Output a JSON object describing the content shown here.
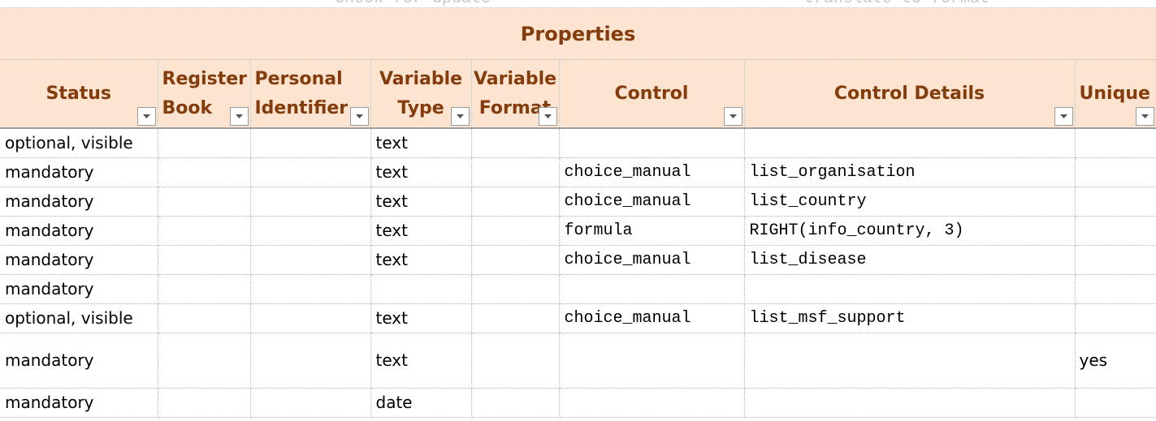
{
  "top_strip": {
    "left_text": "Check for update",
    "right_text": "translate to format"
  },
  "banner": {
    "title": "Properties"
  },
  "columns": [
    {
      "label": "Status",
      "filter_icon": "dropdown-arrow-icon"
    },
    {
      "label": "Register\nBook",
      "filter_icon": "dropdown-arrow-icon"
    },
    {
      "label": "Personal\nIdentifier",
      "filter_icon": "dropdown-arrow-icon"
    },
    {
      "label": "Variable\nType",
      "filter_icon": "dropdown-arrow-icon"
    },
    {
      "label": "Variable\nFormat",
      "filter_icon": "dropdown-arrow-icon"
    },
    {
      "label": "Control",
      "filter_icon": "dropdown-arrow-icon"
    },
    {
      "label": "Control Details",
      "filter_icon": "dropdown-arrow-icon"
    },
    {
      "label": "Unique",
      "filter_icon": "dropdown-arrow-icon"
    }
  ],
  "rows": [
    {
      "status": "optional, visible",
      "register_book": "",
      "personal_identifier": "",
      "variable_type": "text",
      "variable_format": "",
      "control": "",
      "control_details": "",
      "unique": ""
    },
    {
      "status": "mandatory",
      "register_book": "",
      "personal_identifier": "",
      "variable_type": "text",
      "variable_format": "",
      "control": "choice_manual",
      "control_details": "list_organisation",
      "unique": ""
    },
    {
      "status": "mandatory",
      "register_book": "",
      "personal_identifier": "",
      "variable_type": "text",
      "variable_format": "",
      "control": "choice_manual",
      "control_details": "list_country",
      "unique": ""
    },
    {
      "status": "mandatory",
      "register_book": "",
      "personal_identifier": "",
      "variable_type": "text",
      "variable_format": "",
      "control": "formula",
      "control_details": "RIGHT(info_country, 3)",
      "unique": ""
    },
    {
      "status": "mandatory",
      "register_book": "",
      "personal_identifier": "",
      "variable_type": "text",
      "variable_format": "",
      "control": "choice_manual",
      "control_details": "list_disease",
      "unique": ""
    },
    {
      "status": "mandatory",
      "register_book": "",
      "personal_identifier": "",
      "variable_type": "",
      "variable_format": "",
      "control": "",
      "control_details": "",
      "unique": ""
    },
    {
      "status": "optional, visible",
      "register_book": "",
      "personal_identifier": "",
      "variable_type": "text",
      "variable_format": "",
      "control": "choice_manual",
      "control_details": "list_msf_support",
      "unique": ""
    },
    {
      "status": "mandatory",
      "register_book": "",
      "personal_identifier": "",
      "variable_type": "text",
      "variable_format": "",
      "control": "",
      "control_details": "",
      "unique": "yes"
    },
    {
      "status": "mandatory",
      "register_book": "",
      "personal_identifier": "",
      "variable_type": "date",
      "variable_format": "",
      "control": "",
      "control_details": "",
      "unique": ""
    }
  ]
}
